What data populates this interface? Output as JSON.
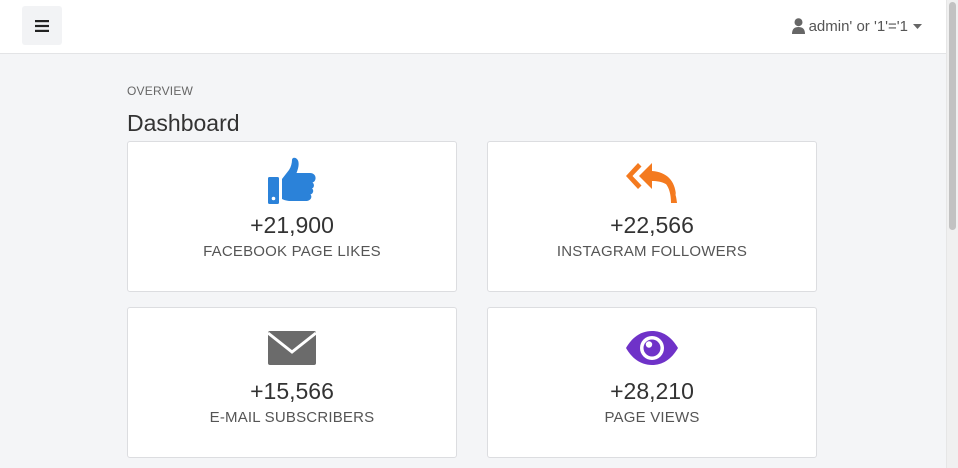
{
  "header": {
    "user_label": "admin' or '1'='1"
  },
  "main": {
    "section_label": "OVERVIEW",
    "title": "Dashboard",
    "cards": [
      {
        "value": "+21,900",
        "label": "FACEBOOK PAGE LIKES",
        "icon": "thumbs-up-icon",
        "color": "#2b82d9"
      },
      {
        "value": "+22,566",
        "label": "INSTAGRAM FOLLOWERS",
        "icon": "reply-all-icon",
        "color": "#f47a1f"
      },
      {
        "value": "+15,566",
        "label": "E-MAIL SUBSCRIBERS",
        "icon": "envelope-icon",
        "color": "#6b6b6b"
      },
      {
        "value": "+28,210",
        "label": "PAGE VIEWS",
        "icon": "eye-icon",
        "color": "#6f32c8"
      }
    ]
  }
}
